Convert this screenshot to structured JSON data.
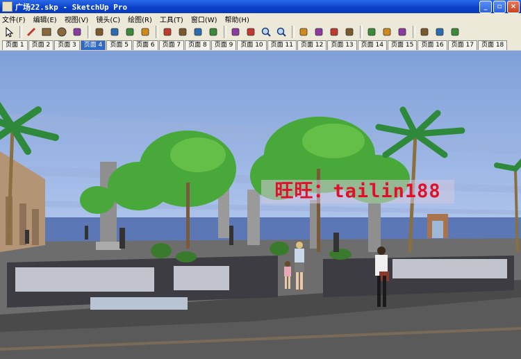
{
  "window": {
    "title": "广场22.skp - SketchUp Pro"
  },
  "menu": [
    "文件(F)",
    "编辑(E)",
    "视图(V)",
    "镜头(C)",
    "绘图(R)",
    "工具(T)",
    "窗口(W)",
    "帮助(H)"
  ],
  "toolbar": [
    "select-icon",
    "sep",
    "pencil-icon",
    "rectangle-icon",
    "circle-icon",
    "arc-icon",
    "sep",
    "make-component-icon",
    "eraser-icon",
    "paint-bucket-icon",
    "push-pull-icon",
    "sep",
    "move-icon",
    "rotate-icon",
    "follow-me-icon",
    "offset-icon",
    "sep",
    "orbit-icon",
    "pan-icon",
    "zoom-icon",
    "zoom-extents-icon",
    "sep",
    "tape-measure-icon",
    "dimension-icon",
    "protractor-icon",
    "axes-icon",
    "sep",
    "walk-icon",
    "position-camera-icon",
    "look-around-icon",
    "sep",
    "get-models-icon",
    "share-model-icon",
    "components-icon"
  ],
  "tabs": [
    "页面 1",
    "页面 2",
    "页面 3",
    "页面 4",
    "页面 5",
    "页面 6",
    "页面 7",
    "页面 8",
    "页面 9",
    "页面 10",
    "页面 11",
    "页面 12",
    "页面 13",
    "页面 14",
    "页面 15",
    "页面 16",
    "页面 17",
    "页面 18"
  ],
  "active_tab": 3,
  "watermark": "旺旺：tailin188",
  "colors": {
    "title_bar": "#0a3fc8",
    "sky": "#8fb0e6",
    "active_tab": "#316ac5",
    "watermark": "#e0102a"
  }
}
